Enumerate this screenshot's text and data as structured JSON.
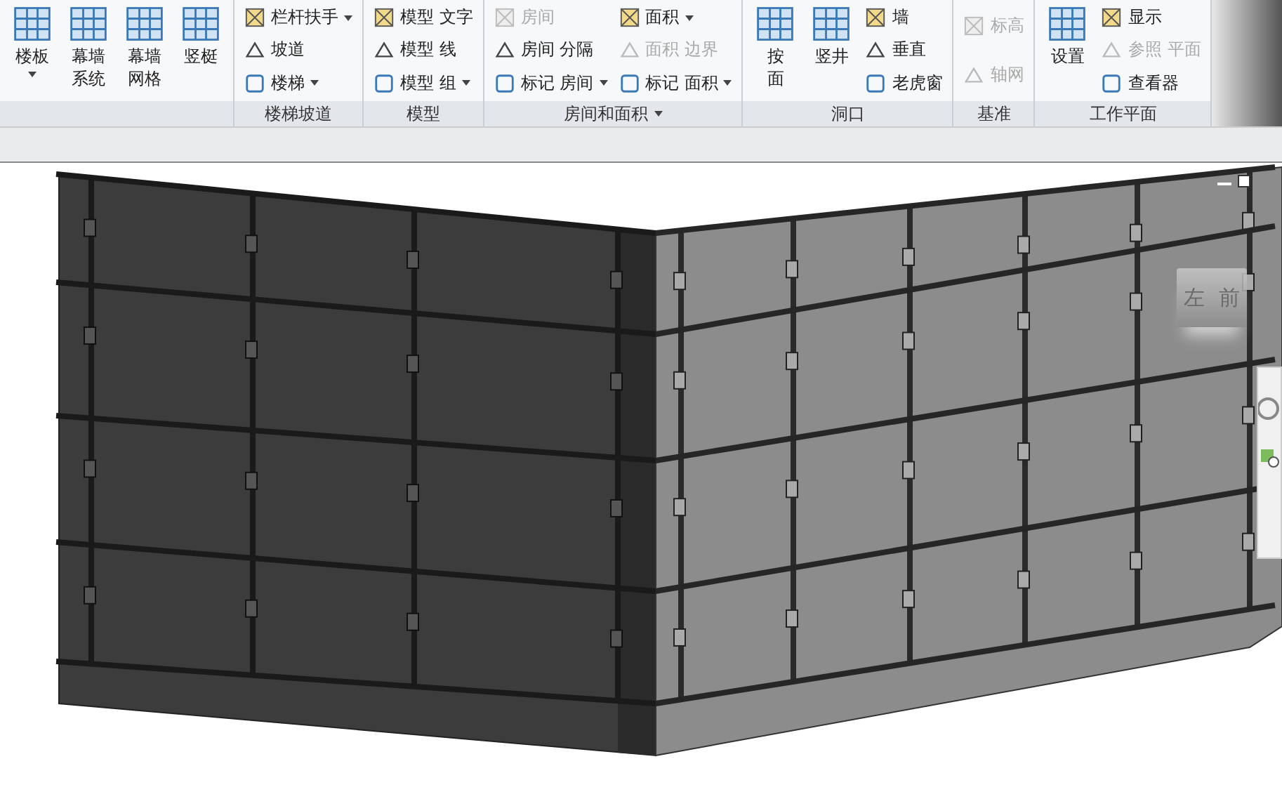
{
  "ribbon": {
    "panels": [
      {
        "title_dropdown": false,
        "columns": [
          {
            "kind": "large",
            "lines": [
              "楼板"
            ],
            "dropdown": true,
            "disabled": false
          },
          {
            "kind": "large",
            "lines": [
              "幕墙",
              "系统"
            ],
            "dropdown": false,
            "disabled": false
          },
          {
            "kind": "large",
            "lines": [
              "幕墙",
              "网格"
            ],
            "dropdown": false,
            "disabled": false
          },
          {
            "kind": "large",
            "lines": [
              "竖梃"
            ],
            "dropdown": false,
            "disabled": false
          }
        ]
      },
      {
        "title": "楼梯坡道",
        "title_dropdown": false,
        "columns": [
          {
            "kind": "stack",
            "items": [
              {
                "label": "栏杆扶手",
                "dropdown": true,
                "disabled": false
              },
              {
                "label": "坡道",
                "dropdown": false,
                "disabled": false
              },
              {
                "label": "楼梯",
                "dropdown": true,
                "disabled": false
              }
            ]
          }
        ]
      },
      {
        "title": "模型",
        "title_dropdown": false,
        "columns": [
          {
            "kind": "stack",
            "items": [
              {
                "label": "模型 文字",
                "dropdown": false,
                "disabled": false
              },
              {
                "label": "模型 线",
                "dropdown": false,
                "disabled": false
              },
              {
                "label": "模型 组",
                "dropdown": true,
                "disabled": false
              }
            ]
          }
        ]
      },
      {
        "title": "房间和面积",
        "title_dropdown": true,
        "columns": [
          {
            "kind": "stack",
            "items": [
              {
                "label": "房间",
                "dropdown": false,
                "disabled": true
              },
              {
                "label": "房间 分隔",
                "dropdown": false,
                "disabled": false
              },
              {
                "label": "标记 房间",
                "dropdown": true,
                "disabled": false
              }
            ]
          },
          {
            "kind": "stack",
            "items": [
              {
                "label": "面积",
                "dropdown": true,
                "disabled": false
              },
              {
                "label": "面积 边界",
                "dropdown": false,
                "disabled": true
              },
              {
                "label": "标记 面积",
                "dropdown": true,
                "disabled": false
              }
            ]
          }
        ]
      },
      {
        "title": "洞口",
        "title_dropdown": false,
        "columns": [
          {
            "kind": "large",
            "lines": [
              "按",
              "面"
            ],
            "dropdown": false,
            "disabled": false
          },
          {
            "kind": "large",
            "lines": [
              "竖井"
            ],
            "dropdown": false,
            "disabled": false
          },
          {
            "kind": "stack",
            "items": [
              {
                "label": "墙",
                "dropdown": false,
                "disabled": false
              },
              {
                "label": "垂直",
                "dropdown": false,
                "disabled": false
              },
              {
                "label": "老虎窗",
                "dropdown": false,
                "disabled": false
              }
            ]
          }
        ]
      },
      {
        "title": "基准",
        "title_dropdown": false,
        "columns": [
          {
            "kind": "stack",
            "items": [
              {
                "label": "标高",
                "dropdown": false,
                "disabled": true
              },
              {
                "label": "轴网",
                "dropdown": false,
                "disabled": true
              }
            ]
          }
        ]
      },
      {
        "title": "工作平面",
        "title_dropdown": false,
        "columns": [
          {
            "kind": "large",
            "lines": [
              "设置"
            ],
            "dropdown": false,
            "disabled": false
          },
          {
            "kind": "stack",
            "items": [
              {
                "label": "显示",
                "dropdown": false,
                "disabled": false
              },
              {
                "label": "参照 平面",
                "dropdown": false,
                "disabled": true
              },
              {
                "label": "查看器",
                "dropdown": false,
                "disabled": false
              }
            ]
          }
        ]
      }
    ]
  },
  "view_cube": {
    "left_face": "左",
    "front_face": "前"
  }
}
